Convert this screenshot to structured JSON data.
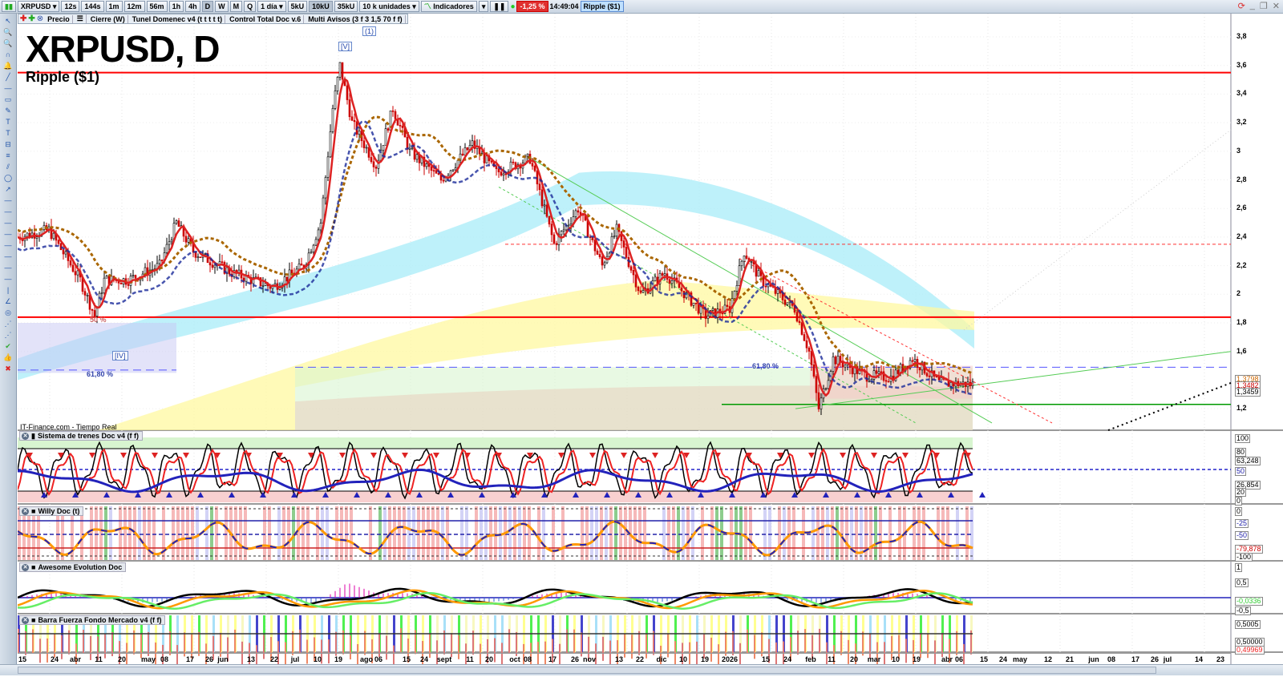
{
  "toolbar": {
    "symbol": "XRPUSD",
    "timeframes": [
      "12s",
      "144s",
      "1m",
      "12m",
      "56m",
      "1h",
      "4h",
      "D",
      "W",
      "M",
      "Q"
    ],
    "active_tf": "D",
    "period": "1 día",
    "units": [
      "5kU",
      "10kU",
      "35kU"
    ],
    "active_unit": "10kU",
    "unit_select": "10 k unidades",
    "indicators": "Indicadores",
    "change": "-1,25 %",
    "time": "14:49:04",
    "instrument": "Ripple ($1)"
  },
  "overlay_bar": {
    "items": [
      "Precio",
      "Cierre (W)",
      "Tunel Domenec v4 (t t t t t)",
      "Control Total Doc v.6",
      "Multi Avisos (3 f 3 1,5 70 f f)"
    ]
  },
  "chart": {
    "title": "XRPUSD, D",
    "subtitle": "Ripple ($1)",
    "source": "IT-Finance.com - Tiempo Real",
    "waves": [
      "[V]",
      "(1)",
      "[IV]"
    ],
    "fib_labels": [
      "61,80 %",
      "61,80 %",
      "50 %"
    ],
    "price_ticks": [
      "3,8",
      "3,6",
      "3,4",
      "3,2",
      "3",
      "2,8",
      "2,6",
      "2,4",
      "2,2",
      "2",
      "1,8",
      "1,6",
      "1,2"
    ],
    "price_boxes": [
      "1,3798",
      "1,3482",
      "1,3459"
    ],
    "colors": {
      "up": "#000000",
      "down": "#cc0000",
      "resistance": "#ff0000",
      "support": "#009900"
    }
  },
  "chart_data": {
    "type": "candlestick",
    "price_path": [
      [
        0,
        2.4
      ],
      [
        13,
        2.45
      ],
      [
        26,
        2.1
      ],
      [
        32,
        1.85
      ],
      [
        36,
        2.1
      ],
      [
        46,
        2.1
      ],
      [
        59,
        2.2
      ],
      [
        66,
        2.5
      ],
      [
        73,
        2.3
      ],
      [
        89,
        2.15
      ],
      [
        106,
        2.05
      ],
      [
        119,
        2.2
      ],
      [
        126,
        2.5
      ],
      [
        131,
        3.3
      ],
      [
        134,
        3.6
      ],
      [
        139,
        3.2
      ],
      [
        149,
        2.9
      ],
      [
        156,
        3.3
      ],
      [
        163,
        3.0
      ],
      [
        176,
        2.8
      ],
      [
        189,
        3.05
      ],
      [
        199,
        2.85
      ],
      [
        213,
        2.95
      ],
      [
        223,
        2.35
      ],
      [
        233,
        2.6
      ],
      [
        243,
        2.2
      ],
      [
        249,
        2.45
      ],
      [
        259,
        2.0
      ],
      [
        269,
        2.15
      ],
      [
        286,
        1.85
      ],
      [
        296,
        1.9
      ],
      [
        302,
        2.3
      ],
      [
        309,
        2.1
      ],
      [
        323,
        1.9
      ],
      [
        329,
        1.6
      ],
      [
        333,
        1.2
      ],
      [
        339,
        1.55
      ],
      [
        353,
        1.43
      ],
      [
        363,
        1.42
      ],
      [
        372,
        1.55
      ],
      [
        383,
        1.38
      ],
      [
        397,
        1.37
      ]
    ],
    "ylim": [
      1.1,
      3.9
    ],
    "levels": {
      "resistance_high": 3.55,
      "resistance_mid": 1.84,
      "dashed_red": 2.35,
      "fib_blue": 1.49,
      "support": 1.23
    }
  },
  "panels": [
    {
      "title": "Sistema de trenes Doc v4 (f f)",
      "ticks": [
        "100",
        "80",
        "63,248",
        "50",
        "26,854",
        "20",
        "0"
      ]
    },
    {
      "title": "Willy Doc (t)",
      "ticks": [
        "0",
        "-25",
        "-50",
        "-79,878",
        "-100"
      ]
    },
    {
      "title": "Awesome Evolution Doc",
      "ticks": [
        "1",
        "0,5",
        "-0,0336",
        "-0,5"
      ]
    },
    {
      "title": "Barra Fuerza Fondo Mercado v4 (f f)",
      "ticks": [
        "0,5005",
        "0,50000",
        "0,49969"
      ]
    }
  ],
  "date_axis": [
    "15",
    "24",
    "abr",
    "11",
    "20",
    "may",
    "08",
    "17",
    "26",
    "jun",
    "13",
    "22",
    "jul",
    "10",
    "19",
    "ago",
    "06",
    "15",
    "24",
    "sept",
    "11",
    "20",
    "oct",
    "08",
    "17",
    "26",
    "nov",
    "13",
    "22",
    "dic",
    "10",
    "19",
    "2026",
    "15",
    "24",
    "feb",
    "11",
    "20",
    "mar",
    "10",
    "19",
    "abr",
    "06",
    "15",
    "24",
    "may",
    "12",
    "21",
    "jun",
    "08",
    "17",
    "26",
    "jul",
    "14",
    "23"
  ]
}
